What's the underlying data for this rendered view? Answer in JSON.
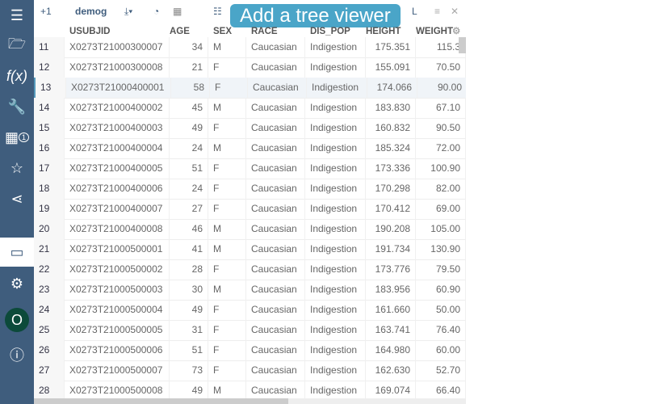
{
  "sidebar": {
    "items": [
      "menu-icon",
      "folder-icon",
      "function-icon",
      "wrench-icon",
      "table-icon",
      "star-icon",
      "share-icon",
      "window-icon",
      "settings-icon",
      "user-avatar",
      "help-icon"
    ],
    "table_badge": "1",
    "avatar_letter": "O"
  },
  "toolbar": {
    "plus_label": "+1",
    "table_name": "demog",
    "tooltip": "Add a tree viewer",
    "trailing": "L"
  },
  "grid": {
    "columns": [
      "USUBJID",
      "AGE",
      "SEX",
      "RACE",
      "DIS_POP",
      "HEIGHT",
      "WEIGHT"
    ],
    "rows": [
      [
        "11",
        "X0273T21000300007",
        "34",
        "M",
        "Caucasian",
        "Indigestion",
        "175.351",
        "115.3"
      ],
      [
        "12",
        "X0273T21000300008",
        "21",
        "F",
        "Caucasian",
        "Indigestion",
        "155.091",
        "70.50"
      ],
      [
        "13",
        "X0273T21000400001",
        "58",
        "F",
        "Caucasian",
        "Indigestion",
        "174.066",
        "90.00"
      ],
      [
        "14",
        "X0273T21000400002",
        "45",
        "M",
        "Caucasian",
        "Indigestion",
        "183.830",
        "67.10"
      ],
      [
        "15",
        "X0273T21000400003",
        "49",
        "F",
        "Caucasian",
        "Indigestion",
        "160.832",
        "90.50"
      ],
      [
        "16",
        "X0273T21000400004",
        "24",
        "M",
        "Caucasian",
        "Indigestion",
        "185.324",
        "72.00"
      ],
      [
        "17",
        "X0273T21000400005",
        "51",
        "F",
        "Caucasian",
        "Indigestion",
        "173.336",
        "100.90"
      ],
      [
        "18",
        "X0273T21000400006",
        "24",
        "F",
        "Caucasian",
        "Indigestion",
        "170.298",
        "82.00"
      ],
      [
        "19",
        "X0273T21000400007",
        "27",
        "F",
        "Caucasian",
        "Indigestion",
        "170.412",
        "69.00"
      ],
      [
        "20",
        "X0273T21000400008",
        "46",
        "M",
        "Caucasian",
        "Indigestion",
        "190.208",
        "105.00"
      ],
      [
        "21",
        "X0273T21000500001",
        "41",
        "M",
        "Caucasian",
        "Indigestion",
        "191.734",
        "130.90"
      ],
      [
        "22",
        "X0273T21000500002",
        "28",
        "F",
        "Caucasian",
        "Indigestion",
        "173.776",
        "79.50"
      ],
      [
        "23",
        "X0273T21000500003",
        "30",
        "M",
        "Caucasian",
        "Indigestion",
        "183.956",
        "60.90"
      ],
      [
        "24",
        "X0273T21000500004",
        "49",
        "F",
        "Caucasian",
        "Indigestion",
        "161.660",
        "50.00"
      ],
      [
        "25",
        "X0273T21000500005",
        "31",
        "F",
        "Caucasian",
        "Indigestion",
        "163.741",
        "76.40"
      ],
      [
        "26",
        "X0273T21000500006",
        "51",
        "F",
        "Caucasian",
        "Indigestion",
        "164.980",
        "60.00"
      ],
      [
        "27",
        "X0273T21000500007",
        "73",
        "F",
        "Caucasian",
        "Indigestion",
        "162.630",
        "52.70"
      ],
      [
        "28",
        "X0273T21000500008",
        "49",
        "M",
        "Caucasian",
        "Indigestion",
        "169.074",
        "66.40"
      ]
    ],
    "selected_row": "13"
  }
}
